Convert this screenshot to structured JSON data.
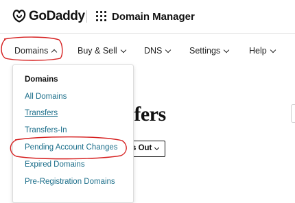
{
  "header": {
    "brand": "GoDaddy",
    "app_title": "Domain Manager",
    "logo_icon": "godaddy-logo",
    "apps_icon": "grid-icon"
  },
  "nav": {
    "items": [
      {
        "label": "Domains",
        "chevron": "up"
      },
      {
        "label": "Buy & Sell",
        "chevron": "down"
      },
      {
        "label": "DNS",
        "chevron": "down"
      },
      {
        "label": "Settings",
        "chevron": "down"
      },
      {
        "label": "Help",
        "chevron": "down"
      }
    ]
  },
  "dropdown": {
    "header": "Domains",
    "items": [
      {
        "label": "All Domains"
      },
      {
        "label": "Transfers"
      },
      {
        "label": "Transfers-In"
      },
      {
        "label": "Pending Account Changes"
      },
      {
        "label": "Expired Domains"
      },
      {
        "label": "Pre-Registration Domains"
      }
    ]
  },
  "main": {
    "title_fragment": "nsfers",
    "filter_button_label": "s Out"
  },
  "colors": {
    "link": "#1b6e8a",
    "annotation": "#d62020",
    "text": "#111111"
  }
}
